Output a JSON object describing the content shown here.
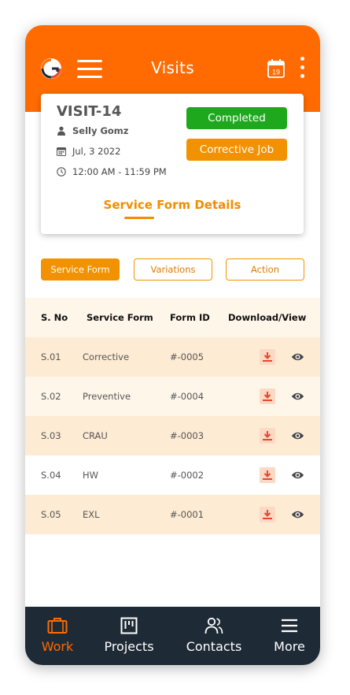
{
  "header": {
    "title": "Visits",
    "calendar_day": "19",
    "background_color": "#FF6B00",
    "icons": [
      "app-logo-icon",
      "menu-icon",
      "calendar-icon",
      "more-vertical-icon"
    ]
  },
  "visit_card": {
    "visit_id": "VISIT-14",
    "customer": "Selly Gomz",
    "date": "Jul, 3 2022",
    "time": "12:00 AM - 11:59 PM",
    "status_label": "Completed",
    "status_color": "#1EA81E",
    "job_label": "Corrective Job",
    "job_color": "#F29200",
    "link_label": "Service Form Details"
  },
  "tabs": [
    {
      "label": "Service Form",
      "active": true
    },
    {
      "label": "Variations",
      "active": false
    },
    {
      "label": "Action",
      "active": false
    }
  ],
  "table": {
    "headers": [
      "S. No",
      "Service Form",
      "Form ID",
      "Download/View"
    ],
    "rows": [
      {
        "sno": "S.01",
        "form": "Corrective",
        "form_id": "#-0005"
      },
      {
        "sno": "S.02",
        "form": "Preventive",
        "form_id": "#-0004"
      },
      {
        "sno": "S.03",
        "form": "CRAU",
        "form_id": "#-0003"
      },
      {
        "sno": "S.04",
        "form": "HW",
        "form_id": "#-0002"
      },
      {
        "sno": "S.05",
        "form": "EXL",
        "form_id": "#-0001"
      }
    ]
  },
  "bottom_nav": [
    {
      "label": "Work",
      "icon": "briefcase-icon",
      "active": true
    },
    {
      "label": "Projects",
      "icon": "kanban-board-icon",
      "active": false
    },
    {
      "label": "Contacts",
      "icon": "users-icon",
      "active": false
    },
    {
      "label": "More",
      "icon": "menu-icon",
      "active": false
    }
  ],
  "colors": {
    "accent": "#FF6B00",
    "link": "#F28C00",
    "nav_background": "#1E2B36",
    "download_icon": "#E8472B"
  }
}
